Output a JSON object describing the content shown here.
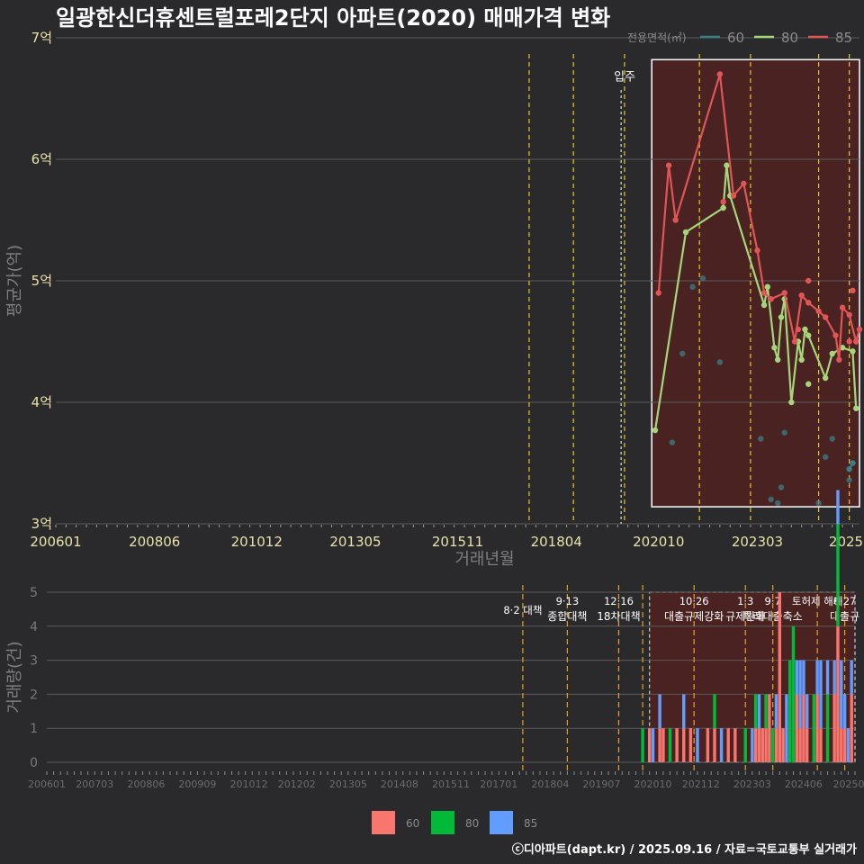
{
  "title": "일광한신더휴센트럴포레2단지 아파트(2020) 매매가격 변화",
  "footer": "ⓒ디아파트(dapt.kr) / 2025.09.16 / 자료=국토교통부 실거래가",
  "colors": {
    "bg": "#2a2a2c",
    "grid": "#5a5a5a",
    "s60": "#3a7f86",
    "s80": "#a4d67a",
    "s85": "#e05555",
    "bar60": "#f8766d",
    "bar80": "#00ba38",
    "bar85": "#619cff",
    "bar_purple": "#a37fcc",
    "policy_line": "#e8c820",
    "highlight_fill": "#4a2222"
  },
  "chart_data": [
    {
      "type": "line",
      "title": "일광한신더휴센트럴포레2단지 아파트(2020) 매매가격 변화",
      "xlabel": "거래년월",
      "ylabel": "평균가(억)",
      "ylim": [
        3,
        7
      ],
      "xlim": [
        "2006-01",
        "2025-09"
      ],
      "x_tick_labels": [
        "200601",
        "200806",
        "201012",
        "201305",
        "201511",
        "201804",
        "202010",
        "202303",
        "2025"
      ],
      "y_tick_labels": [
        "3억",
        "4억",
        "5억",
        "6억",
        "7억"
      ],
      "legend": {
        "title": "전용면적(㎡)",
        "items": [
          "60",
          "80",
          "85"
        ],
        "placement": "top-right"
      },
      "annotation": "입주",
      "policy_dates": [
        "2017-08",
        "2018-09",
        "2019-12",
        "2021-10",
        "2023-01",
        "2024-09",
        "2025-06"
      ],
      "series": [
        {
          "name": "60",
          "line": [
            [
              "2025-06",
              3.45
            ],
            [
              "2025-07",
              3.5
            ]
          ],
          "points": [
            [
              "2021-02",
              3.67
            ],
            [
              "2021-05",
              4.4
            ],
            [
              "2021-08",
              4.95
            ],
            [
              "2021-11",
              5.02
            ],
            [
              "2022-04",
              4.33
            ],
            [
              "2023-04",
              3.7
            ],
            [
              "2023-07",
              3.2
            ],
            [
              "2023-09",
              3.17
            ],
            [
              "2023-10",
              3.3
            ],
            [
              "2023-11",
              3.75
            ],
            [
              "2024-09",
              3.17
            ],
            [
              "2024-11",
              3.55
            ],
            [
              "2025-01",
              3.7
            ],
            [
              "2025-06",
              3.36
            ]
          ]
        },
        {
          "name": "80",
          "line": [
            [
              "2020-09",
              3.77
            ],
            [
              "2021-06",
              5.4
            ],
            [
              "2022-05",
              5.6
            ],
            [
              "2022-06",
              5.95
            ],
            [
              "2022-07",
              5.7
            ],
            [
              "2023-05",
              4.8
            ],
            [
              "2023-06",
              4.95
            ],
            [
              "2023-08",
              4.45
            ],
            [
              "2023-09",
              4.35
            ],
            [
              "2023-10",
              4.7
            ],
            [
              "2023-11",
              4.85
            ],
            [
              "2024-01",
              4.0
            ],
            [
              "2024-03",
              4.5
            ],
            [
              "2024-04",
              4.35
            ],
            [
              "2024-05",
              4.6
            ],
            [
              "2024-06",
              4.55
            ],
            [
              "2024-11",
              4.2
            ],
            [
              "2025-01",
              4.4
            ],
            [
              "2025-04",
              4.45
            ],
            [
              "2025-07",
              4.42
            ],
            [
              "2025-08",
              3.95
            ]
          ],
          "points": [
            [
              "2024-06",
              4.15
            ]
          ]
        },
        {
          "name": "85",
          "line": [
            [
              "2020-10",
              4.9
            ],
            [
              "2021-01",
              5.95
            ],
            [
              "2021-03",
              5.5
            ],
            [
              "2022-04",
              6.7
            ],
            [
              "2022-08",
              5.7
            ],
            [
              "2022-11",
              5.8
            ],
            [
              "2023-03",
              5.25
            ],
            [
              "2023-05",
              4.9
            ],
            [
              "2023-07",
              4.85
            ],
            [
              "2023-11",
              4.9
            ],
            [
              "2024-02",
              4.5
            ],
            [
              "2024-04",
              4.88
            ],
            [
              "2024-06",
              4.82
            ],
            [
              "2024-09",
              4.75
            ],
            [
              "2024-11",
              4.7
            ],
            [
              "2025-02",
              4.55
            ],
            [
              "2025-03",
              4.35
            ],
            [
              "2025-04",
              4.78
            ],
            [
              "2025-06",
              4.72
            ],
            [
              "2025-08",
              4.5
            ],
            [
              "2025-09",
              4.6
            ]
          ],
          "points": [
            [
              "2022-05",
              5.65
            ],
            [
              "2024-06",
              5.0
            ],
            [
              "2024-03",
              4.6
            ],
            [
              "2025-07",
              4.92
            ],
            [
              "2025-06",
              4.5
            ]
          ]
        }
      ]
    },
    {
      "type": "bar",
      "xlabel": "",
      "ylabel": "거래량(건)",
      "ylim": [
        0,
        5
      ],
      "y_tick_labels": [
        "0",
        "1",
        "2",
        "3",
        "4",
        "5"
      ],
      "x_tick_labels": [
        "200601",
        "200703",
        "200806",
        "200909",
        "201012",
        "201202",
        "201305",
        "201408",
        "201511",
        "201701",
        "201804",
        "201907",
        "202010",
        "202112",
        "202303",
        "202406",
        "20250"
      ],
      "legend": {
        "items": [
          "60",
          "80",
          "85"
        ],
        "placement": "bottom"
      },
      "policies": [
        {
          "date": "2017-08",
          "lines": [
            "8·2 대책"
          ]
        },
        {
          "date": "2018-09",
          "lines": [
            "9·13",
            "종합대책"
          ]
        },
        {
          "date": "2019-12",
          "lines": [
            "12·16",
            "18차대책"
          ]
        },
        {
          "date": "2020-07",
          "lines": []
        },
        {
          "date": "2021-10",
          "lines": [
            "10·26",
            "대출규제강화"
          ]
        },
        {
          "date": "2023-01",
          "lines": [
            "1·3",
            "규제완화"
          ]
        },
        {
          "date": "2023-09",
          "lines": [
            "9·7",
            "특례대출축소"
          ]
        },
        {
          "date": "2024-10",
          "lines": [
            "토허제 해제"
          ]
        },
        {
          "date": "2025-06",
          "lines": [
            "6·27",
            "대출규"
          ]
        }
      ],
      "bars": [
        {
          "date": "2020-07",
          "s60": 0,
          "s80": 1,
          "s85": 0
        },
        {
          "date": "2020-09",
          "s60": 1,
          "s80": 0,
          "s85": 0
        },
        {
          "date": "2020-10",
          "s60": 0,
          "s80": 0,
          "s85": 1
        },
        {
          "date": "2020-12",
          "s60": 1,
          "s80": 0,
          "s85": 1
        },
        {
          "date": "2021-01",
          "s60": 1,
          "s80": 0,
          "s85": 0
        },
        {
          "date": "2021-03",
          "s60": 0,
          "s80": 1,
          "s85": 0
        },
        {
          "date": "2021-05",
          "s60": 1,
          "s80": 0,
          "s85": 0
        },
        {
          "date": "2021-07",
          "s60": 1,
          "s80": 0,
          "s85": 1
        },
        {
          "date": "2021-09",
          "s60": 1,
          "s80": 0,
          "s85": 0
        },
        {
          "date": "2021-11",
          "s60": 0,
          "s80": 0,
          "s85": 1
        },
        {
          "date": "2022-02",
          "s60": 1,
          "s80": 0,
          "s85": 0
        },
        {
          "date": "2022-04",
          "s60": 1,
          "s80": 1,
          "s85": 0
        },
        {
          "date": "2022-06",
          "s60": 0,
          "s80": 0,
          "s85": 1
        },
        {
          "date": "2022-08",
          "s60": 1,
          "s80": 0,
          "s85": 0
        },
        {
          "date": "2022-10",
          "s60": 1,
          "s80": 0,
          "s85": 0
        },
        {
          "date": "2023-01",
          "s60": 0,
          "s80": 1,
          "s85": 0
        },
        {
          "date": "2023-03",
          "s60": 0,
          "s80": 0,
          "s85": 1
        },
        {
          "date": "2023-04",
          "s60": 1,
          "s80": 1,
          "s85": 0
        },
        {
          "date": "2023-05",
          "s60": 1,
          "s80": 0,
          "s85": 1
        },
        {
          "date": "2023-06",
          "s60": 1,
          "s80": 0,
          "s85": 0
        },
        {
          "date": "2023-07",
          "s60": 1,
          "s80": 1,
          "s85": 0
        },
        {
          "date": "2023-08",
          "s60": 2,
          "s80": 0,
          "s85": 0
        },
        {
          "date": "2023-09",
          "s60": 0,
          "s80": 1,
          "s85": 0
        },
        {
          "date": "2023-10",
          "s60": 1,
          "s80": 0,
          "s85": 1
        },
        {
          "date": "2023-11",
          "s60": 5,
          "s80": 0,
          "s85": 0
        },
        {
          "date": "2023-12",
          "s60": 1,
          "s80": 0,
          "s85": 0
        },
        {
          "date": "2024-01",
          "s60": 0,
          "s80": 0,
          "s85": 2
        },
        {
          "date": "2024-02",
          "s60": 0,
          "s80": 3,
          "s85": 0
        },
        {
          "date": "2024-03",
          "s60": 0,
          "s80": 4,
          "s85": 0
        },
        {
          "date": "2024-04",
          "s60": 2,
          "s80": 0,
          "s85": 1
        },
        {
          "date": "2024-05",
          "s60": 1,
          "s80": 0,
          "s85": 2
        },
        {
          "date": "2024-06",
          "s60": 2,
          "s80": 0,
          "s85": 1
        },
        {
          "date": "2024-07",
          "s60": 1,
          "s80": 0,
          "s85": 1
        },
        {
          "date": "2024-09",
          "s60": 0,
          "s80": 2,
          "s85": 0
        },
        {
          "date": "2024-10",
          "s60": 2,
          "s80": 0,
          "s85": 1
        },
        {
          "date": "2024-11",
          "s60": 1,
          "s80": 0,
          "s85": 2
        },
        {
          "date": "2025-01",
          "s60": 0,
          "s80": 2,
          "s85": 1
        },
        {
          "date": "2025-03",
          "s60": 2,
          "s80": 0,
          "s85": 1
        },
        {
          "date": "2025-04",
          "s60": 4,
          "s80": 3,
          "s85": 1
        },
        {
          "date": "2025-05",
          "s60": 1,
          "s80": 0,
          "s85": 2
        },
        {
          "date": "2025-06",
          "s60": 1,
          "s80": 0,
          "s85": 1
        },
        {
          "date": "2025-07",
          "s60": 0,
          "s80": 0,
          "s85": 1
        },
        {
          "date": "2025-08",
          "s60": 2,
          "s80": 0,
          "s85": 1
        }
      ]
    }
  ]
}
